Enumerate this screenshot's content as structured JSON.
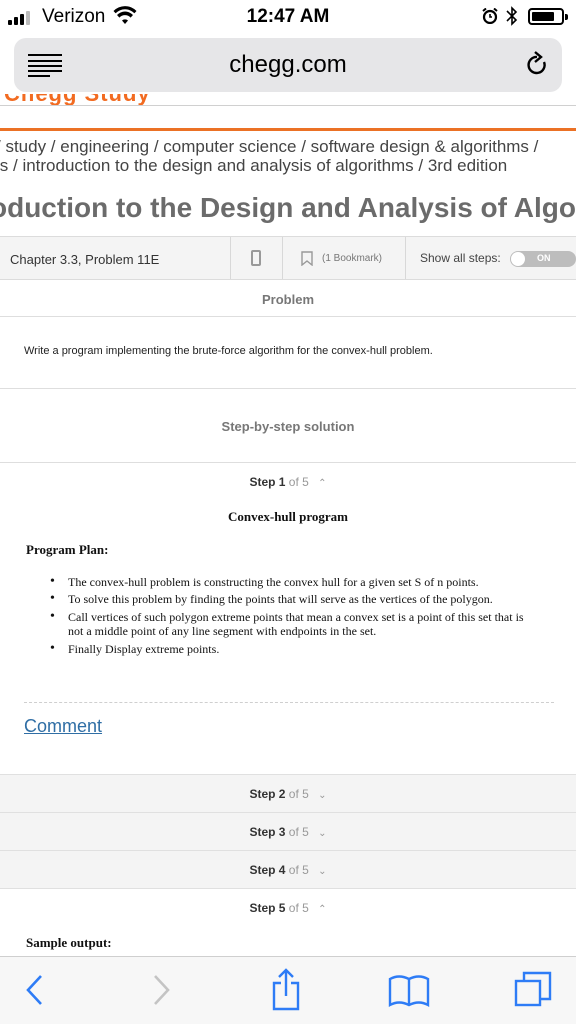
{
  "status_bar": {
    "carrier": "Verizon",
    "time": "12:47 AM",
    "battery_level": 0.8
  },
  "browser": {
    "url": "chegg.com"
  },
  "page": {
    "breadcrumb_line1": "/ study / engineering / computer science / software design & algorithms /",
    "breadcrumb_line2": "ls / introduction to the design and analysis of algorithms / 3rd edition",
    "title": "oduction to the Design and Analysis of Algo"
  },
  "toolbar": {
    "chapter": "Chapter 3.3, Problem 11E",
    "bookmark": "(1 Bookmark)",
    "show_all_steps": "Show all steps:",
    "toggle": "ON"
  },
  "problem": {
    "heading": "Problem",
    "text": "Write a program implementing the brute-force algorithm for the convex-hull problem."
  },
  "solution": {
    "heading": "Step-by-step solution",
    "steps": [
      {
        "label": "Step 1",
        "of": "of 5",
        "expanded": true
      },
      {
        "label": "Step 2",
        "of": "of 5",
        "expanded": false
      },
      {
        "label": "Step 3",
        "of": "of 5",
        "expanded": false
      },
      {
        "label": "Step 4",
        "of": "of 5",
        "expanded": false
      },
      {
        "label": "Step 5",
        "of": "of 5",
        "expanded": true
      }
    ],
    "step1": {
      "title": "Convex-hull program",
      "plan_title": "Program Plan:",
      "bullets": [
        "The convex-hull problem is constructing the convex hull for a given set S of n points.",
        "To solve this problem by finding the points that will serve as the vertices of the polygon.",
        "Call vertices of such polygon extreme points that mean a convex set is a point of this set that is not a middle point of any line segment with endpoints in the set.",
        "Finally Display extreme points."
      ],
      "comment": "Comment"
    },
    "step5": {
      "sample_title": "Sample output:"
    }
  },
  "icons": [
    "signal-icon",
    "wifi-icon",
    "alarm-icon",
    "bluetooth-icon",
    "battery-icon",
    "reader-icon",
    "reload-icon",
    "phone-icon",
    "bookmark-icon",
    "back-icon",
    "forward-icon",
    "share-icon",
    "bookmarks-icon",
    "tabs-icon"
  ]
}
